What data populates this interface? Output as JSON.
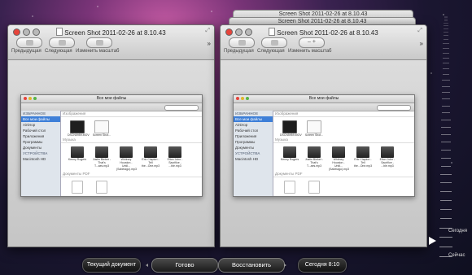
{
  "window_title": "Screen Shot 2011-02-26 at 8.10.43",
  "toolbar": {
    "prev_label": "Предыдущая",
    "next_label": "Следующая",
    "zoom_label": "Изменить масштаб"
  },
  "finder": {
    "title": "Все мои файлы",
    "sidebar_heading_1": "ИЗБРАННОЕ",
    "sidebar_items": [
      "Все мои файлы",
      "AirDrop",
      "Рабочий стол",
      "Приложения",
      "Программы",
      "Документы"
    ],
    "sidebar_heading_2": "УСТРОЙСТВА",
    "device_item": "Macintosh HD",
    "section_images": "Изображения",
    "section_music": "Музыка",
    "section_docs": "Документы PDF",
    "image_files": [
      "DSCN5959.MOV",
      "Screen Shot..."
    ],
    "music_files": [
      "Kenny Rogers",
      "Justin Bieber - That's T...aes.mp3",
      "Whitney Houston - Until...(Sabeiago).mp3",
      "Eric Clapton - Tell the...One.mp3",
      "Elton John - Sacrifice - ...ble.mp3",
      "Mumford & Sons..."
    ]
  },
  "timeline": {
    "today_label": "Сегодня",
    "now_label": "Сейчас"
  },
  "bottom_bar": {
    "current_doc_label": "Текущий документ",
    "done_label": "Готово",
    "restore_label": "Восстановить",
    "today_time_label": "Сегодня 8:10"
  }
}
